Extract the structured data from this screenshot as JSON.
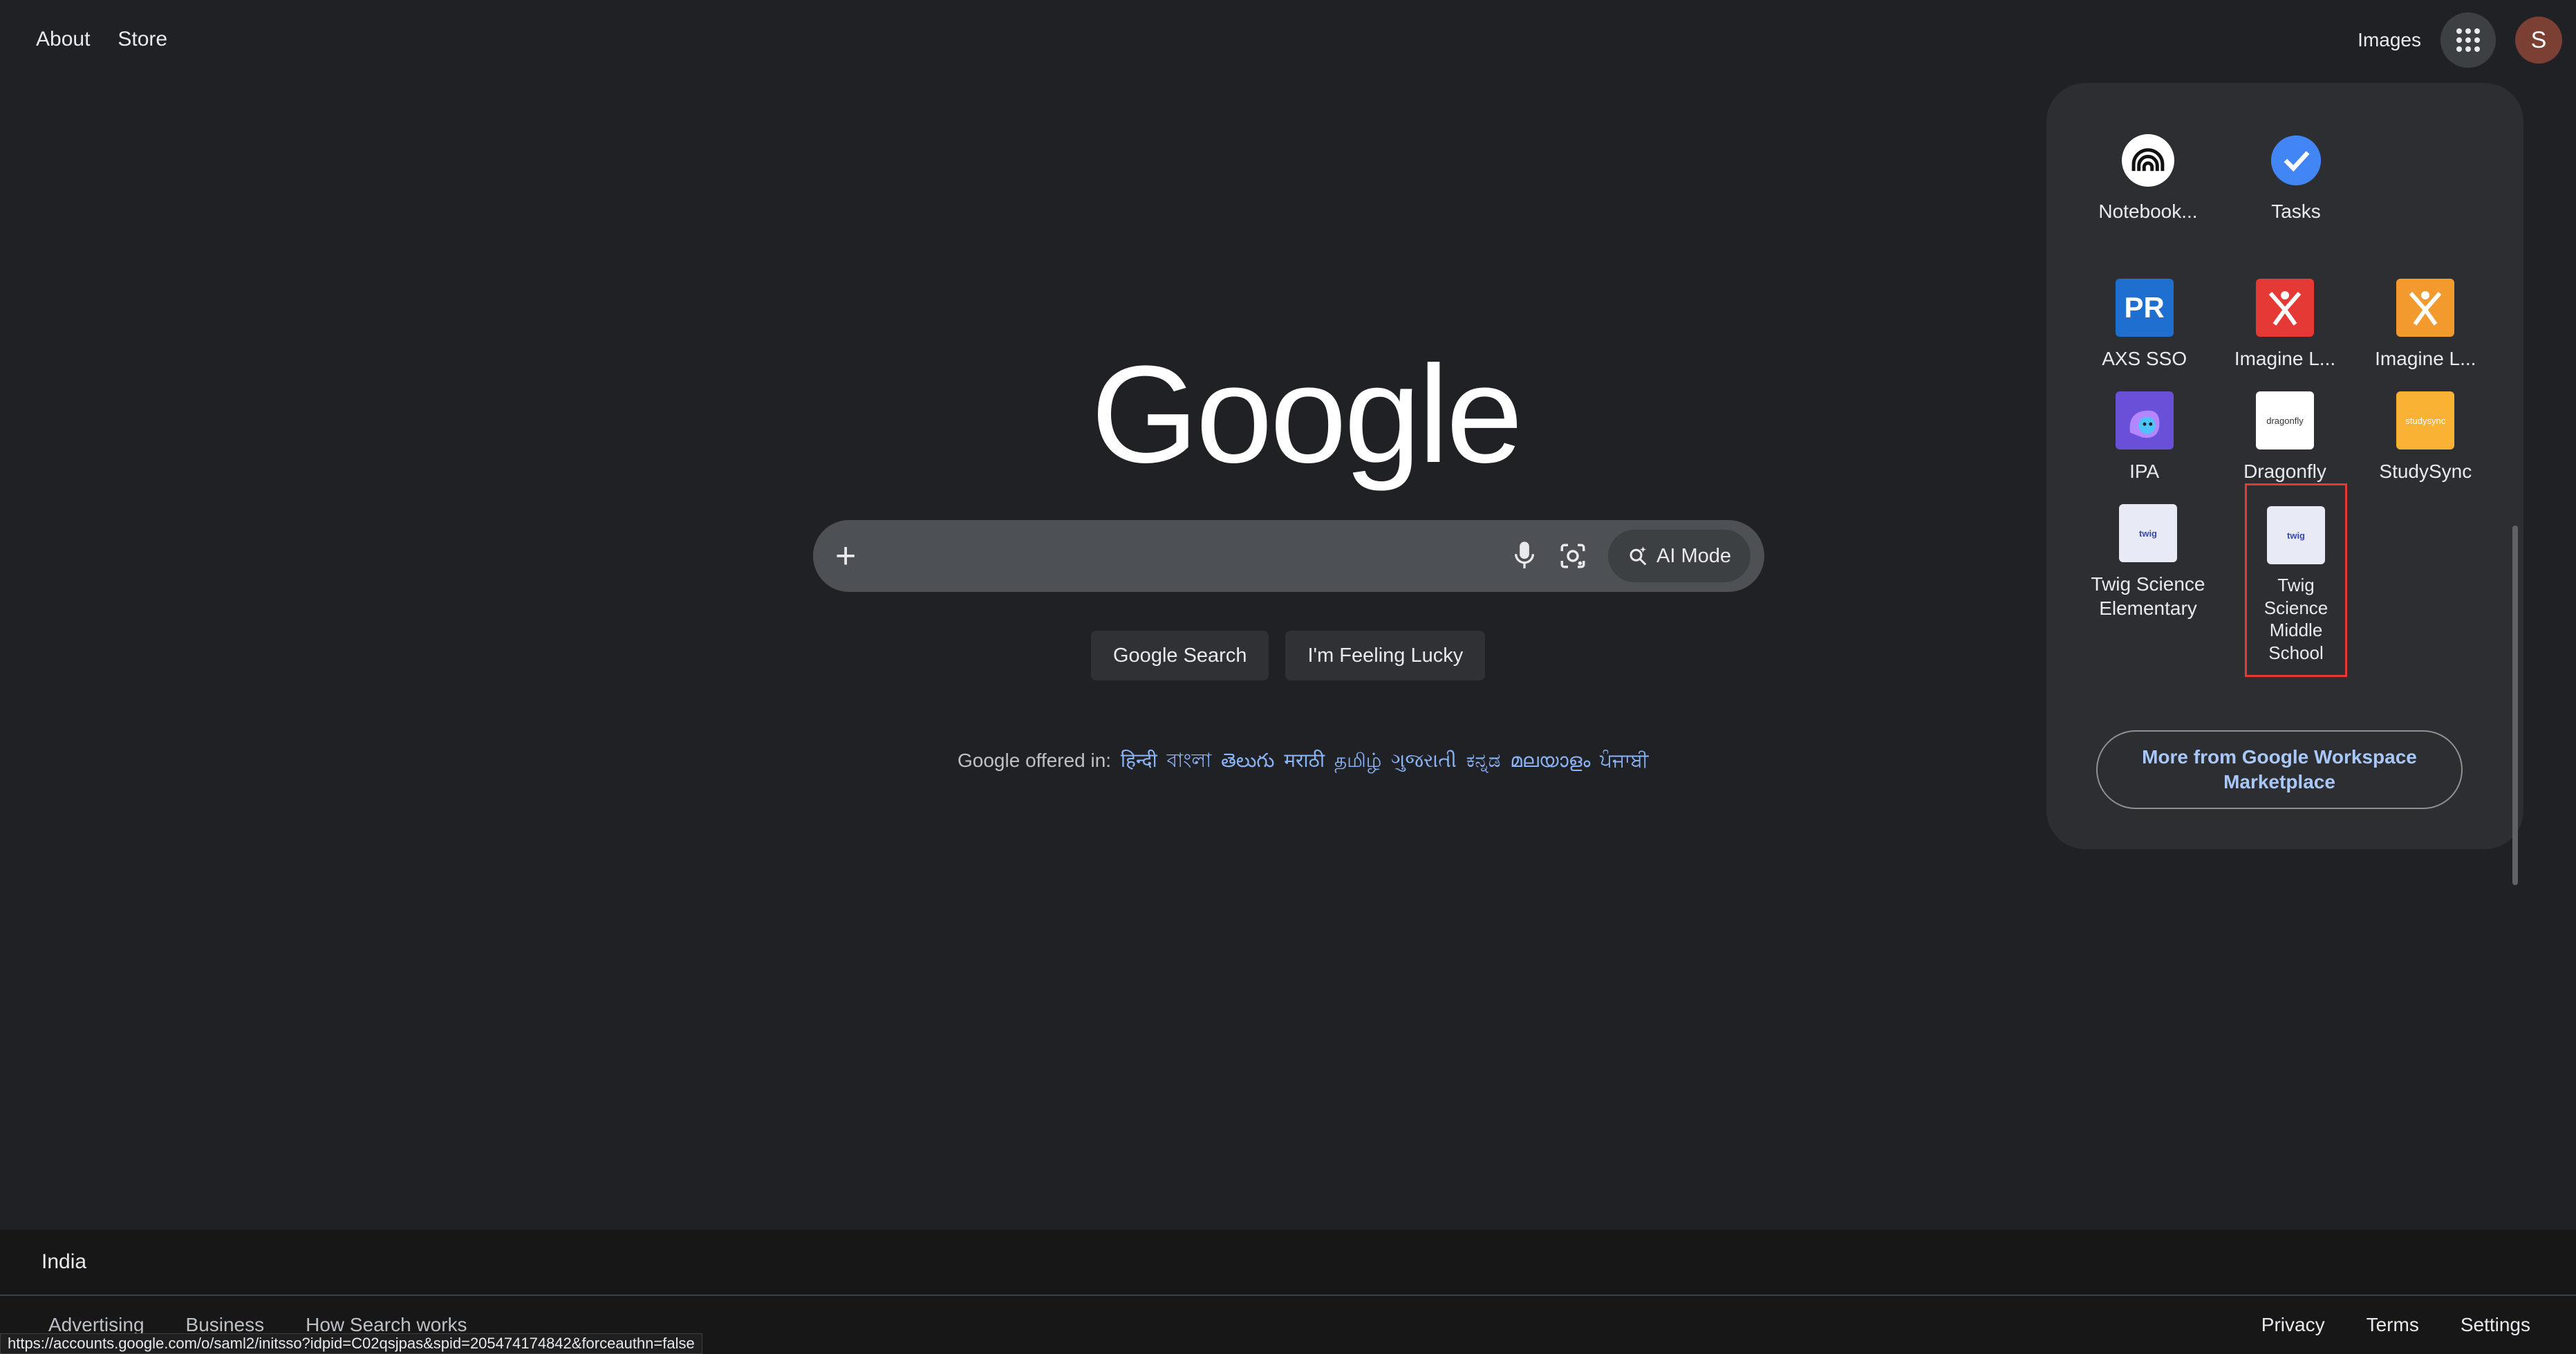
{
  "header": {
    "left_links": [
      "About",
      "Store"
    ],
    "images_link": "Images",
    "avatar_letter": "S"
  },
  "logo": "Google",
  "search": {
    "value": "",
    "placeholder": "",
    "ai_mode_label": "AI Mode"
  },
  "buttons": {
    "search": "Google Search",
    "lucky": "I'm Feeling Lucky"
  },
  "offered": {
    "prefix": "Google offered in:",
    "languages": [
      "हिन्दी",
      "বাংলা",
      "తెలుగు",
      "मराठी",
      "தமிழ்",
      "ગુજરાતી",
      "ಕನ್ನಡ",
      "മലയാളം",
      "ਪੰਜਾਬੀ"
    ]
  },
  "apps_panel": {
    "rows": [
      [
        {
          "label": "Notebook...",
          "icon": "notebooklm-icon"
        },
        {
          "label": "Tasks",
          "icon": "tasks-icon"
        }
      ],
      [
        {
          "label": "AXS SSO",
          "icon": "axs-sso-icon"
        },
        {
          "label": "Imagine L...",
          "icon": "imagine-learning-red-icon"
        },
        {
          "label": "Imagine L...",
          "icon": "imagine-learning-orange-icon"
        }
      ],
      [
        {
          "label": "IPA",
          "icon": "ipa-icon"
        },
        {
          "label": "Dragonfly",
          "icon": "dragonfly-icon"
        },
        {
          "label": "StudySync",
          "icon": "studysync-icon"
        }
      ],
      [
        {
          "label": "Twig Science Elementary",
          "icon": "twig-science-icon"
        },
        {
          "label": "Twig Science Middle School",
          "icon": "twig-science-icon",
          "selected": true
        }
      ]
    ],
    "icon_text": {
      "axs": "PR",
      "dragonfly": "dragonfly",
      "studysync": "studysync",
      "twig": "twig"
    },
    "marketplace_label": "More from Google Workspace Marketplace"
  },
  "footer": {
    "country": "India",
    "left_links": [
      "Advertising",
      "Business",
      "How Search works"
    ],
    "right_links": [
      "Privacy",
      "Terms",
      "Settings"
    ]
  },
  "status_url": "https://accounts.google.com/o/saml2/initsso?idpid=C02qsjpas&spid=205474174842&forceauthn=false",
  "colors": {
    "background": "#202124",
    "link": "#8ab4f8",
    "selected_outline": "#e53935"
  }
}
